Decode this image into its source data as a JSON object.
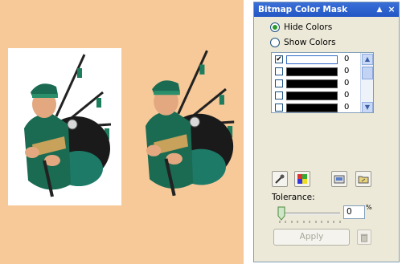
{
  "panel": {
    "title": "Bitmap Color Mask",
    "hide_colors_label": "Hide Colors",
    "show_colors_label": "Show Colors",
    "selected_mode": "Hide Colors",
    "tolerance_label": "Tolerance:",
    "tolerance_value": "0",
    "tolerance_unit": "%",
    "apply_label": "Apply"
  },
  "color_list": [
    {
      "checked": true,
      "checkmark": "✔",
      "color": "#ffffff",
      "tolerance": "0"
    },
    {
      "checked": false,
      "checkmark": "",
      "color": "#000000",
      "tolerance": "0"
    },
    {
      "checked": false,
      "checkmark": "",
      "color": "#000000",
      "tolerance": "0"
    },
    {
      "checked": false,
      "checkmark": "",
      "color": "#000000",
      "tolerance": "0"
    },
    {
      "checked": false,
      "checkmark": "",
      "color": "#000000",
      "tolerance": "0"
    }
  ],
  "icons": {
    "collapse": "collapse-icon",
    "close": "close-icon",
    "color_selector": "eyedropper-icon",
    "edit_color": "edit-color-icon",
    "save_mask": "save-mask-icon",
    "open_mask": "open-mask-icon",
    "remove_mask": "trash-icon"
  },
  "canvas": {
    "background": "#f7c999",
    "images": [
      "bagpiper-original",
      "bagpiper-masked"
    ]
  }
}
